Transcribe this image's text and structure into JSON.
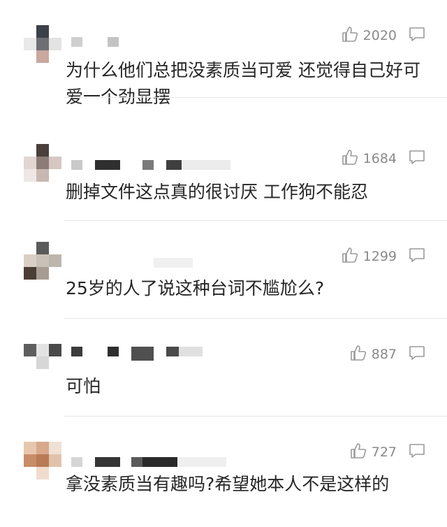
{
  "comments": [
    {
      "likes": "2020",
      "text": "为什么他们总把没素质当可爱 还觉得自己好可爱一个劲显摆"
    },
    {
      "likes": "1684",
      "text": "删掉文件这点真的很讨厌 工作狗不能忍"
    },
    {
      "likes": "1299",
      "text": "25岁的人了说这种台词不尴尬么?"
    },
    {
      "likes": "887",
      "text": "可怕"
    },
    {
      "likes": "727",
      "text": "拿没素质当有趣吗?希望她本人不是这样的"
    }
  ],
  "icons": {
    "like": "thumbs-up-icon",
    "reply": "comment-bubble-icon"
  },
  "colors": {
    "text": "#262626",
    "meta": "#8a8a8a",
    "divider": "#e6e6e6"
  }
}
